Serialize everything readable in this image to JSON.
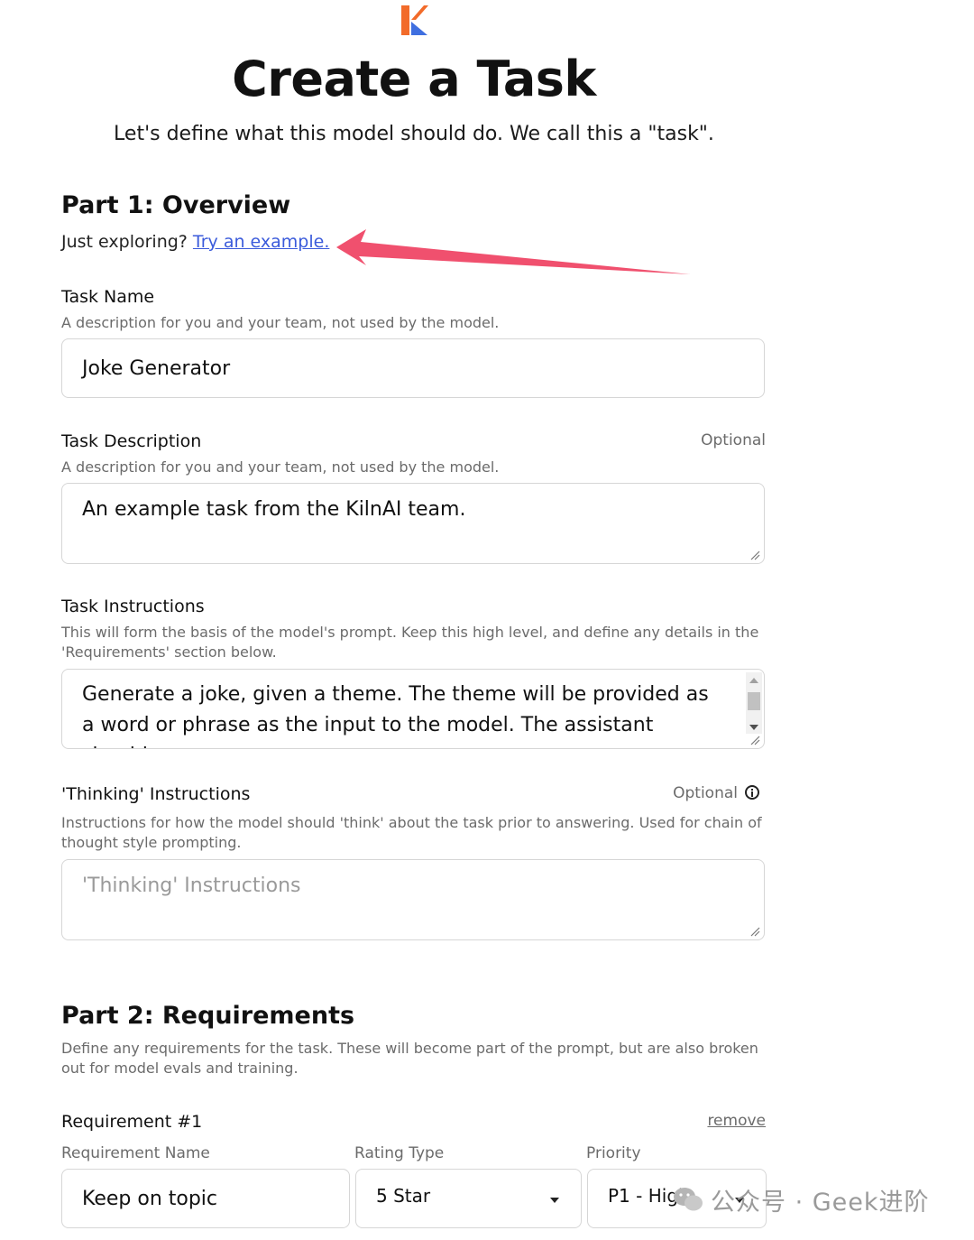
{
  "header": {
    "title": "Create a Task",
    "subtitle": "Let's define what this model should do. We call this a \"task\"."
  },
  "part1": {
    "title": "Part 1: Overview",
    "exploring_text": "Just exploring?",
    "example_link": "Try an example."
  },
  "task_name": {
    "label": "Task Name",
    "description": "A description for you and your team, not used by the model.",
    "value": "Joke Generator"
  },
  "task_description": {
    "label": "Task Description",
    "optional": "Optional",
    "description": "A description for you and your team, not used by the model.",
    "value": "An example task from the KilnAI team."
  },
  "task_instructions": {
    "label": "Task Instructions",
    "description": "This will form the basis of the model's prompt. Keep this high level, and define any details in the 'Requirements' section below.",
    "value": "Generate a joke, given a theme. The theme will be provided as a word or phrase as the input to the model. The assistant should"
  },
  "thinking_instructions": {
    "label": "'Thinking' Instructions",
    "optional": "Optional",
    "description": "Instructions for how the model should 'think' about the task prior to answering. Used for chain of thought style prompting.",
    "placeholder": "'Thinking' Instructions"
  },
  "part2": {
    "title": "Part 2: Requirements",
    "description": "Define any requirements for the task. These will become part of the prompt, but are also broken out for model evals and training."
  },
  "requirement1": {
    "title": "Requirement #1",
    "remove_label": "remove",
    "name_label": "Requirement Name",
    "rating_label": "Rating Type",
    "priority_label": "Priority",
    "name_value": "Keep on topic",
    "rating_value": "5 Star",
    "priority_value": "P1 - High"
  },
  "watermark": {
    "text": "公众号 · Geek进阶"
  },
  "colors": {
    "link": "#3b5bdb",
    "arrow": "#f0506e",
    "logo_orange": "#f26b2a",
    "logo_blue": "#3f6fe0"
  },
  "icons": [
    "kiln-logo-icon",
    "info-icon",
    "chevron-down-icon",
    "resize-grip-icon",
    "annotation-arrow-icon",
    "wechat-icon"
  ]
}
